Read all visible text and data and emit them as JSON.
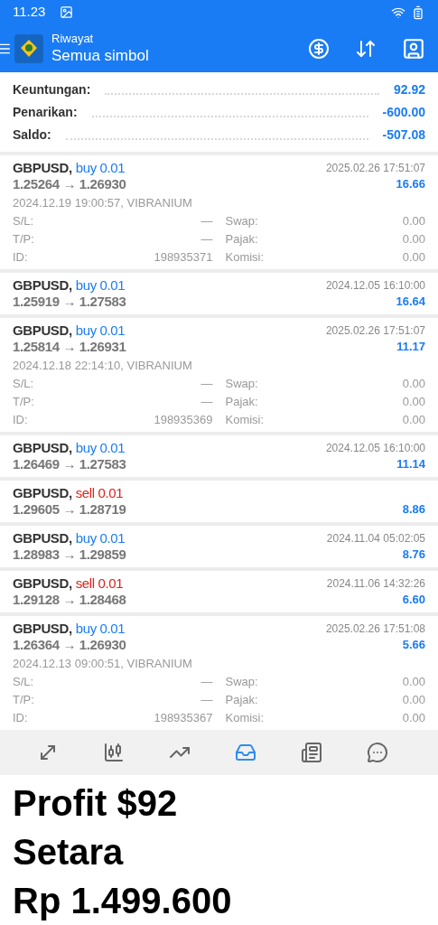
{
  "status_bar": {
    "time": "11.23"
  },
  "app_bar": {
    "title": "Riwayat",
    "subtitle": "Semua simbol"
  },
  "summary": [
    {
      "label": "Keuntungan:",
      "value": "92.92"
    },
    {
      "label": "Penarikan:",
      "value": "-600.00"
    },
    {
      "label": "Saldo:",
      "value": "-507.08"
    }
  ],
  "trades": [
    {
      "symbol": "GBPUSD,",
      "color": "#1a7cf5",
      "order": "buy 0.01",
      "prices": "1.25264 → 1.26930",
      "time": "2025.02.26 17:51:07",
      "profit": "16.66",
      "expanded": true,
      "open_info": "2024.12.19 19:00:57, VIBRANIUM",
      "details": [
        [
          "S/L:",
          "—",
          "Swap:",
          "0.00"
        ],
        [
          "T/P:",
          "—",
          "Pajak:",
          "0.00"
        ],
        [
          "ID:",
          "198935371",
          "Komisi:",
          "0.00"
        ]
      ]
    },
    {
      "symbol": "GBPUSD,",
      "color": "#1a7cf5",
      "order": "buy 0.01",
      "prices": "1.25919 → 1.27583",
      "time": "2024.12.05 16:10:00",
      "profit": "16.64",
      "expanded": false
    },
    {
      "symbol": "GBPUSD,",
      "color": "#1a7cf5",
      "order": "buy 0.01",
      "prices": "1.25814 → 1.26931",
      "time": "2025.02.26 17:51:07",
      "profit": "11.17",
      "expanded": true,
      "open_info": "2024.12.18 22:14:10, VIBRANIUM",
      "details": [
        [
          "S/L:",
          "—",
          "Swap:",
          "0.00"
        ],
        [
          "T/P:",
          "—",
          "Pajak:",
          "0.00"
        ],
        [
          "ID:",
          "198935369",
          "Komisi:",
          "0.00"
        ]
      ]
    },
    {
      "symbol": "GBPUSD,",
      "color": "#1a7cf5",
      "order": "buy 0.01",
      "prices": "1.26469 → 1.27583",
      "time": "2024.12.05 16:10:00",
      "profit": "11.14",
      "expanded": false
    },
    {
      "symbol": "GBPUSD,",
      "color": "#e0201b",
      "order": "sell 0.01",
      "prices": "1.29605 → 1.28719",
      "profit": "8.86",
      "expanded": false
    },
    {
      "symbol": "GBPUSD,",
      "color": "#1a7cf5",
      "order": "buy 0.01",
      "prices": "1.28983 → 1.29859",
      "time": "2024.11.04 05:02:05",
      "profit": "8.76",
      "expanded": false
    },
    {
      "symbol": "GBPUSD,",
      "color": "#e0201b",
      "order": "sell 0.01",
      "prices": "1.29128 → 1.28468",
      "time": "2024.11.06 14:32:26",
      "profit": "6.60",
      "expanded": false
    },
    {
      "symbol": "GBPUSD,",
      "color": "#1a7cf5",
      "order": "buy 0.01",
      "prices": "1.26364 → 1.26930",
      "time": "2025.02.26 17:51:08",
      "profit": "5.66",
      "expanded": true,
      "open_info": "2024.12.13 09:00:51, VIBRANIUM",
      "details": [
        [
          "S/L:",
          "—",
          "Swap:",
          "0.00"
        ],
        [
          "T/P:",
          "—",
          "Pajak:",
          "0.00"
        ],
        [
          "ID:",
          "198935367",
          "Komisi:",
          "0.00"
        ]
      ]
    }
  ],
  "bottom_nav": [
    {
      "kind": "trade",
      "selected": false
    },
    {
      "kind": "quotes",
      "selected": false
    },
    {
      "kind": "chart",
      "selected": false
    },
    {
      "kind": "history",
      "selected": true
    },
    {
      "kind": "news",
      "selected": false
    },
    {
      "kind": "chat",
      "selected": false
    }
  ],
  "caption": [
    "Profit $92",
    "Setara",
    "Rp 1.499.600"
  ]
}
